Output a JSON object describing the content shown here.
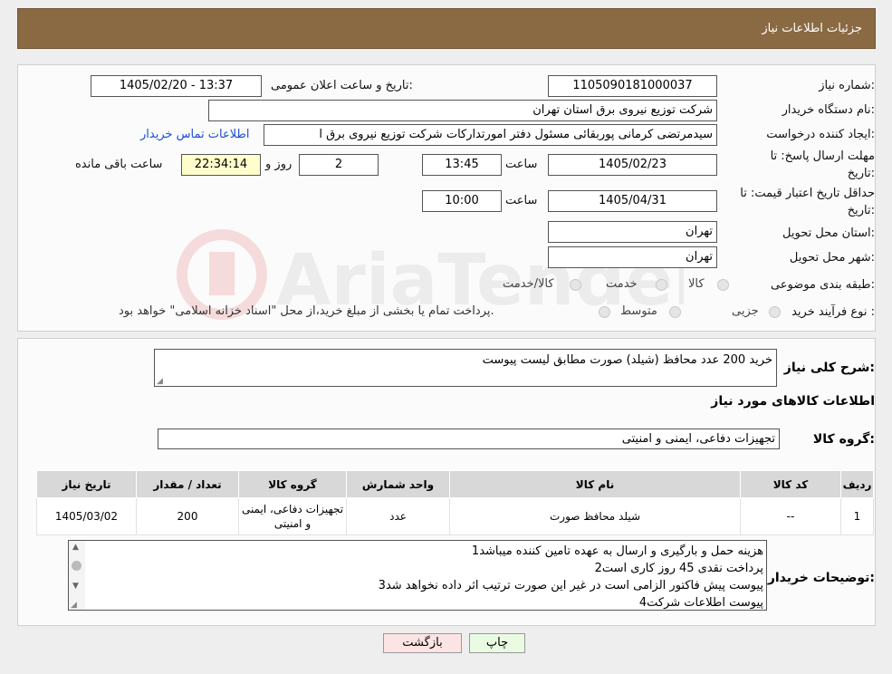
{
  "header": {
    "title": "جزئیات اطلاعات نیاز"
  },
  "fields": {
    "need_number_label": "شماره نیاز:",
    "need_number": "1105090181000037",
    "announce_label": "تاریخ و ساعت اعلان عمومی:",
    "announce_value": "1405/02/20 - 13:37",
    "buyer_org_label": "نام دستگاه خریدار:",
    "buyer_org": "شرکت توزیع نیروی برق استان تهران",
    "creator_label": "ایجاد کننده درخواست:",
    "creator": "سیدمرتضی کرمانی پوربقائی مسئول دفتر امورتدارکات شرکت توزیع نیروی برق ا",
    "buyer_contact_link": "اطلاعات تماس خریدار",
    "deadline_label_1": "مهلت ارسال پاسخ: تا",
    "deadline_label_2": "تاریخ:",
    "deadline_date": "1405/02/23",
    "time_label": "ساعت",
    "deadline_time": "13:45",
    "days_value": "2",
    "days_label": "روز و",
    "remaining_time": "22:34:14",
    "remaining_label": "ساعت باقی مانده",
    "validity_label_1": "حداقل تاریخ اعتبار قیمت: تا",
    "validity_label_2": "تاریخ:",
    "validity_date": "1405/04/31",
    "validity_time": "10:00",
    "province_label": "استان محل تحویل:",
    "province": "تهران",
    "city_label": "شهر محل تحویل:",
    "city": "تهران",
    "category_label": "طبقه بندی موضوعی:",
    "category_options": [
      "کالا",
      "خدمت",
      "کالا/خدمت"
    ],
    "process_label": "نوع فرآیند خرید :",
    "process_options": [
      "جزیی",
      "متوسط"
    ],
    "process_note": "پرداخت تمام یا بخشی از مبلغ خرید،از محل \"اسناد خزانه اسلامی\" خواهد بود."
  },
  "description": {
    "label": "شرح کلی نیاز:",
    "value": "خرید 200 عدد محافظ (شیلد) صورت مطابق لیست پیوست"
  },
  "goods_section": {
    "title": "اطلاعات کالاهای مورد نیاز",
    "group_label": "گروه کالا:",
    "group_value": "تجهیزات دفاعی، ایمنی و امنیتی"
  },
  "table": {
    "headers": [
      "ردیف",
      "کد کالا",
      "نام کالا",
      "واحد شمارش",
      "گروه کالا",
      "تعداد / مقدار",
      "تاریخ نیاز"
    ],
    "rows": [
      [
        "1",
        "--",
        "شیلد محافظ صورت",
        "عدد",
        "تجهیزات دفاعی، ایمنی و امنیتی",
        "200",
        "1405/03/02"
      ]
    ]
  },
  "buyer_notes": {
    "label": "توضیحات خریدار:",
    "lines": [
      "1هزینه حمل و بارگیری و ارسال به عهده تامین کننده میباشد",
      "2پرداخت نقدی 45 روز کاری است",
      "3پیوست پیش فاکتور الزامی است در غیر این صورت ترتیب اثر داده نخواهد شد",
      "4پیوست اطلاعات شرکت"
    ]
  },
  "buttons": {
    "print": "چاپ",
    "back": "بازگشت"
  },
  "colors": {
    "header_bg": "#8a6a43",
    "yellow_box": "#ffffcc",
    "link": "#1a4fd6",
    "print_btn": "#e9fbe2",
    "back_btn": "#fde4e4"
  }
}
